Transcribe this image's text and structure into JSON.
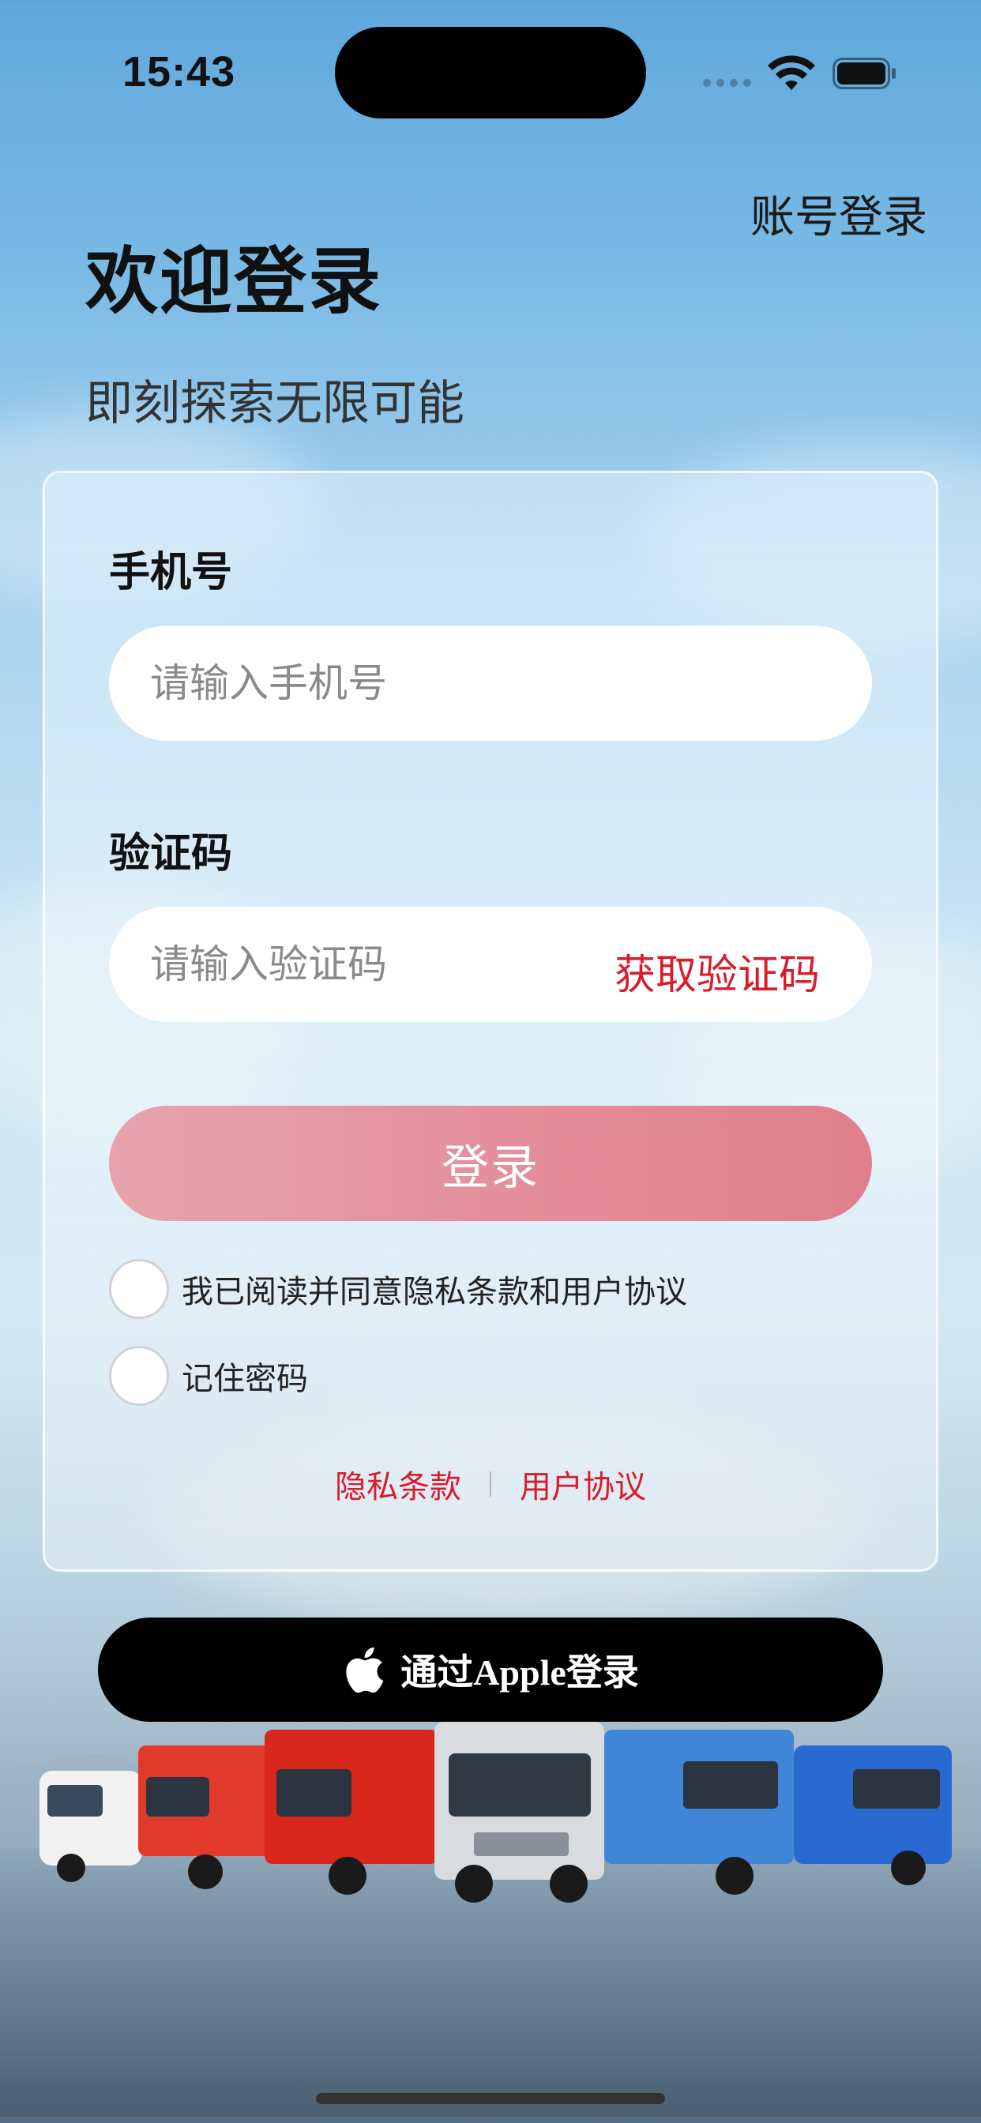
{
  "status_bar": {
    "time": "15:43"
  },
  "header": {
    "account_login": "账号登录",
    "title": "欢迎登录",
    "subtitle": "即刻探索无限可能"
  },
  "form": {
    "phone": {
      "label": "手机号",
      "placeholder": "请输入手机号",
      "value": ""
    },
    "code": {
      "label": "验证码",
      "placeholder": "请输入验证码",
      "value": "",
      "get_code_label": "获取验证码"
    },
    "login_button": "登录",
    "agree_label": "我已阅读并同意隐私条款和用户协议",
    "agree_checked": false,
    "remember_label": "记住密码",
    "remember_checked": false,
    "privacy_link": "隐私条款",
    "terms_link": "用户协议"
  },
  "apple_login": {
    "label": "通过Apple登录",
    "icon": "apple-icon"
  },
  "colors": {
    "accent_red": "#d81c2c",
    "login_button": "#e48e9a",
    "apple_button": "#000000"
  },
  "icons": [
    "signal-icon",
    "wifi-icon",
    "battery-icon",
    "apple-icon"
  ]
}
